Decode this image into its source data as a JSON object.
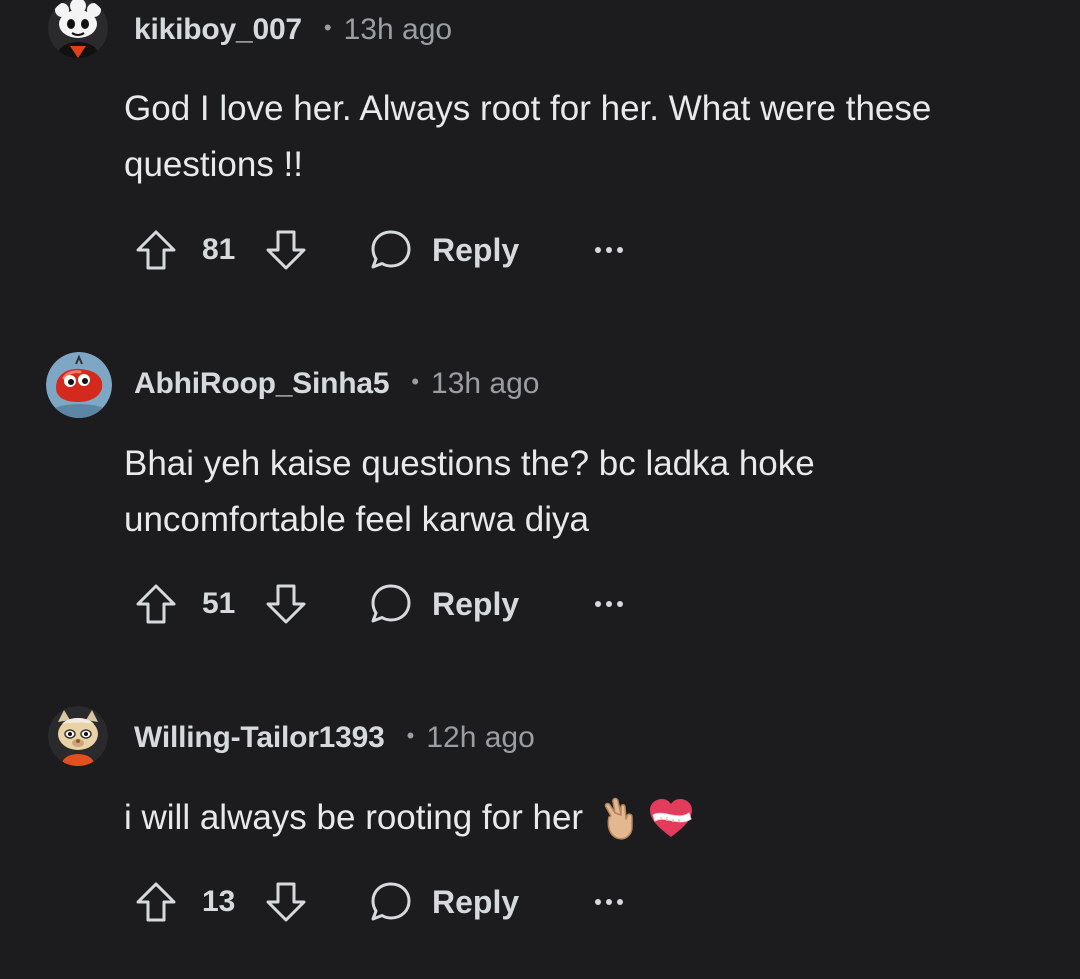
{
  "comments": [
    {
      "username": "kikiboy_007",
      "separator": "•",
      "time": "13h ago",
      "body_lines": [
        "God I love her. Always root for her. What were these",
        "questions !!"
      ],
      "votes": "81",
      "reply_label": "Reply",
      "avatar": "snoo-avatar-white-hair"
    },
    {
      "username": "AbhiRoop_Sinha5",
      "separator": "•",
      "time": "13h ago",
      "body_lines": [
        "Bhai yeh kaise questions the? bc ladka hoke",
        "uncomfortable feel karwa diya"
      ],
      "votes": "51",
      "reply_label": "Reply",
      "avatar": "snoo-avatar-red-bean"
    },
    {
      "username": "Willing-Tailor1393",
      "separator": "•",
      "time": "12h ago",
      "body_lines": [
        "i will always be rooting for her"
      ],
      "body_emojis": [
        "fingers-crossed-emoji",
        "mending-heart-emoji"
      ],
      "votes": "13",
      "reply_label": "Reply",
      "avatar": "snoo-avatar-cat-costume"
    }
  ],
  "icons": {
    "upvote": "upvote-arrow-icon",
    "downvote": "downvote-arrow-icon",
    "reply": "speech-bubble-icon",
    "more": "more-options-icon"
  },
  "colors": {
    "background": "#1c1c1e",
    "text": "#e7e9ea",
    "muted": "#9a9ea2"
  }
}
